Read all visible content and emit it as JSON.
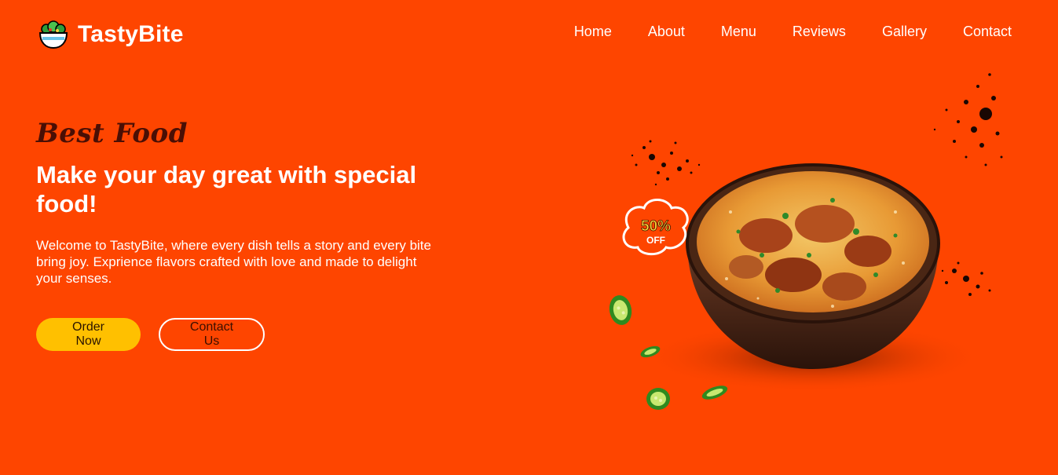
{
  "brand": {
    "name": "TastyBite",
    "logo_icon": "salad-bowl-icon"
  },
  "nav": {
    "items": [
      {
        "label": "Home"
      },
      {
        "label": "About"
      },
      {
        "label": "Menu"
      },
      {
        "label": "Reviews"
      },
      {
        "label": "Gallery"
      },
      {
        "label": "Contact"
      }
    ]
  },
  "hero": {
    "tagline": "Best Food",
    "headline": "Make your day great with special food!",
    "intro": "Welcome to TastyBite, where every dish tells a story and every bite bring joy. Exprience flavors crafted with love and made to delight your senses.",
    "buttons": {
      "order": "Order Now",
      "contact": "Contact Us"
    },
    "badge": {
      "percent": "50%",
      "off": "OFF"
    }
  },
  "colors": {
    "background": "#fe4500",
    "tagline": "#4a0f05",
    "order_button": "#ffc000",
    "text": "#ffffff"
  }
}
